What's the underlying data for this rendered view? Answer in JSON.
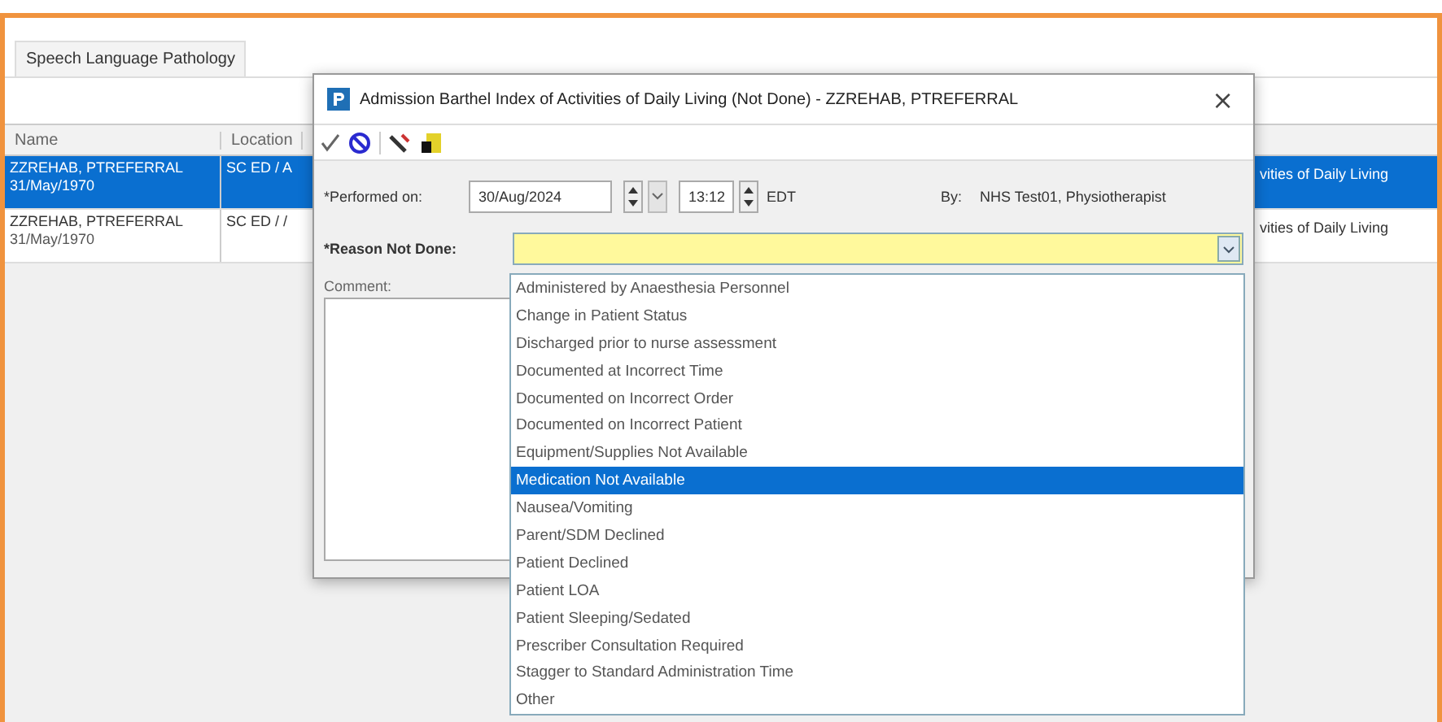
{
  "tab": {
    "label": "Speech Language Pathology",
    "selected": true
  },
  "table": {
    "columns": [
      "Name",
      "Location"
    ],
    "rows": [
      {
        "name": "ZZREHAB, PTREFERRAL",
        "dob": "31/May/1970",
        "location": "SC ED / A",
        "column_3": "vities of Daily Living",
        "selected": true
      },
      {
        "name": "ZZREHAB, PTREFERRAL",
        "dob": "31/May/1970",
        "location": "SC ED / /",
        "column_3": "vities of Daily Living",
        "selected": false
      }
    ]
  },
  "dialog": {
    "title": "Admission Barthel Index of Activities of Daily Living (Not Done) - ZZREHAB, PTREFERRAL",
    "close": "×",
    "performed_label": "*Performed on:",
    "date": "30/Aug/2024",
    "time": "13:12",
    "timezone": "EDT",
    "by_label": "By:",
    "by": "NHS Test01, Physiotherapist",
    "reason_label": "*Reason Not Done:",
    "comment_label": "Comment:",
    "options": [
      {
        "label": "Administered by Anaesthesia Personnel",
        "selected": false
      },
      {
        "label": "Change in Patient Status",
        "selected": false
      },
      {
        "label": "Discharged prior to nurse assessment",
        "selected": false
      },
      {
        "label": "Documented at Incorrect Time",
        "selected": false
      },
      {
        "label": "Documented on Incorrect Order",
        "selected": false
      },
      {
        "label": "Documented on Incorrect Patient",
        "selected": false
      },
      {
        "label": "Equipment/Supplies Not Available",
        "selected": false
      },
      {
        "label": "Medication Not Available",
        "selected": true
      },
      {
        "label": "Nausea/Vomiting",
        "selected": false
      },
      {
        "label": "Parent/SDM Declined",
        "selected": false
      },
      {
        "label": "Patient Declined",
        "selected": false
      },
      {
        "label": "Patient LOA",
        "selected": false
      },
      {
        "label": "Patient Sleeping/Sedated",
        "selected": false
      },
      {
        "label": "Prescriber Consultation Required",
        "selected": false
      },
      {
        "label": "Stagger to Standard Administration Time",
        "selected": false
      },
      {
        "label": "Other",
        "selected": false
      }
    ]
  }
}
